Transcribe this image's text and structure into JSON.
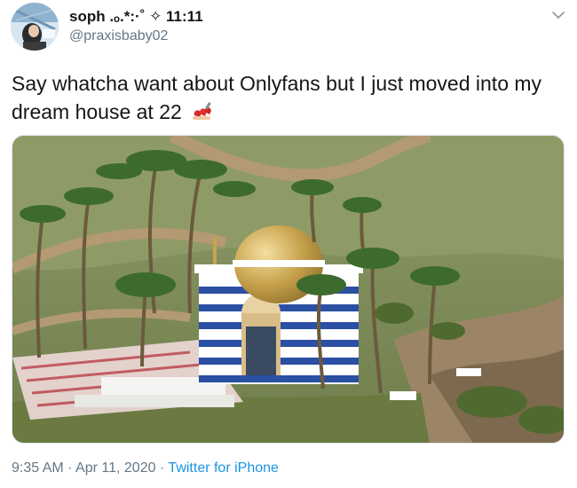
{
  "author": {
    "display_name": "soph .ₒ.*:·˚ ✧ 11:11",
    "handle": "@praxisbaby02",
    "avatar_icon": "profile-photo"
  },
  "tweet": {
    "text": "Say whatcha want about Onlyfans but I just moved into my dream house at 22",
    "emoji_icon": "nail-polish-emoji",
    "media_description_icon": "photo-temple-on-island"
  },
  "meta": {
    "time": "9:35 AM",
    "separator_1": " · ",
    "date": "Apr 11, 2020",
    "separator_2": " · ",
    "source": "Twitter for iPhone"
  },
  "colors": {
    "link": "#1b95e0",
    "secondary_text": "#657786",
    "primary_text": "#14171a"
  }
}
